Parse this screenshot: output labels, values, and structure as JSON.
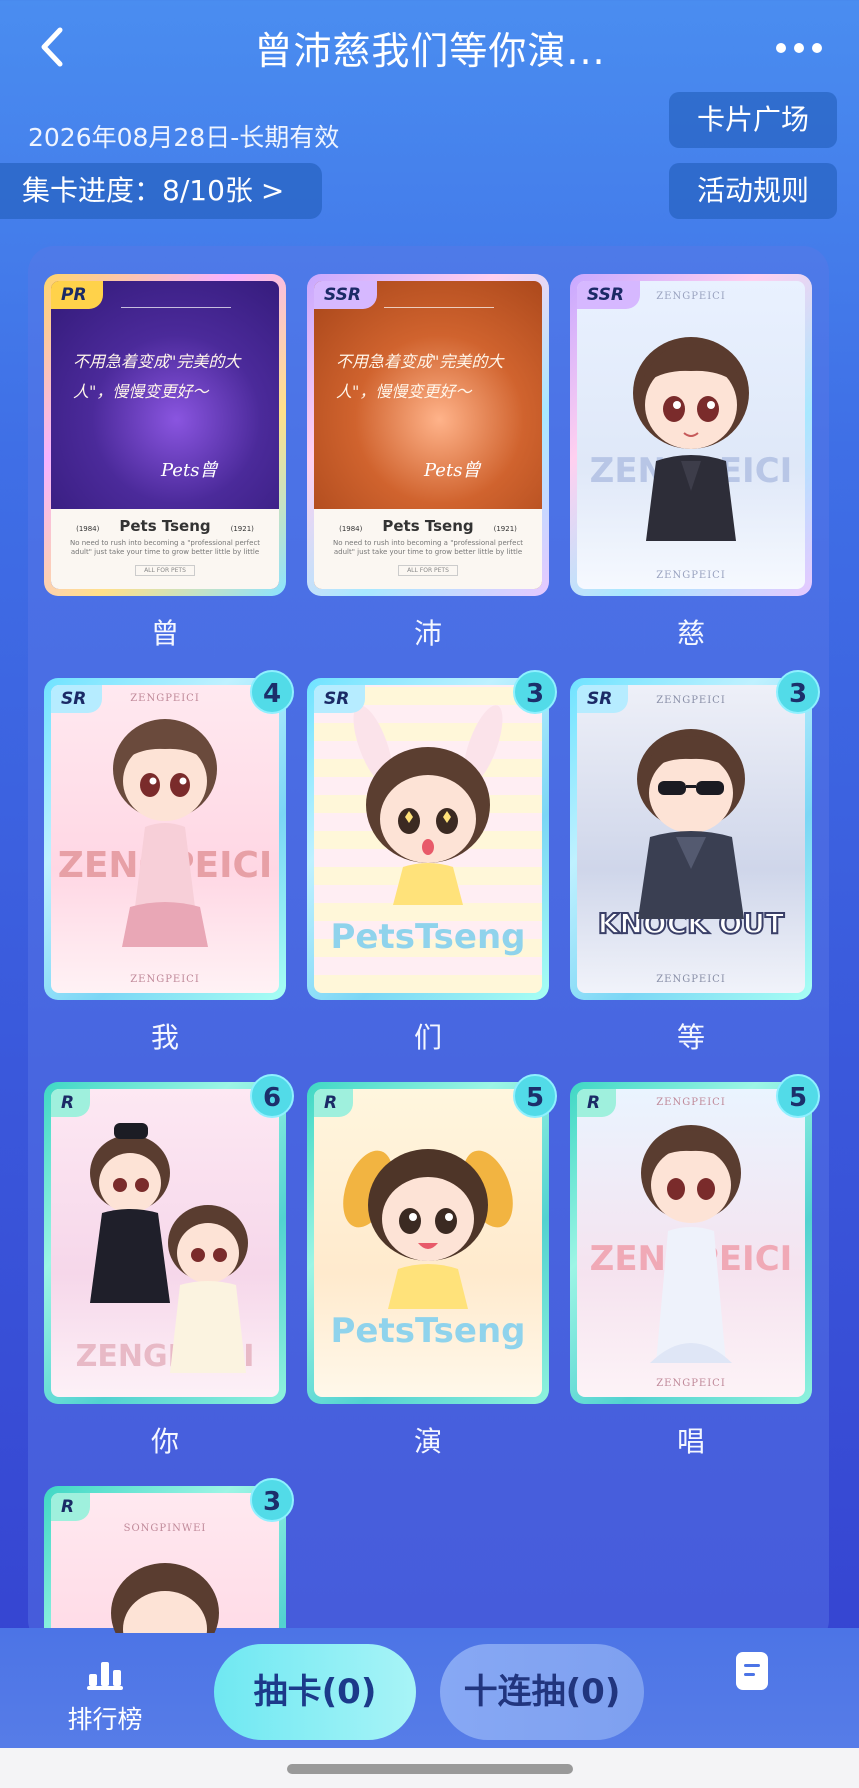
{
  "header": {
    "title": "曾沛慈我们等你演...",
    "back_icon": "chevron-left-icon",
    "more_icon": "more-dots-icon"
  },
  "info": {
    "date_range": "2026年08月28日-长期有效",
    "progress_label": "集卡进度：8/10张",
    "progress_chevron": ">",
    "card_square_label": "卡片广场",
    "rules_label": "活动规则"
  },
  "cards": [
    {
      "label": "曾",
      "rarity": "PR",
      "count": "",
      "style": "poem-purple",
      "name": "Pets Tseng",
      "poem": "不用急着变成\"完美的大人\"，慢慢变更好～",
      "sign": "Pets曾",
      "years_left": "(1984)",
      "years_right": "(1921)",
      "sub": "No need to rush into becoming a \"professional perfect adult\" just take your time to grow better little by little",
      "tag": "ALL FOR PETS"
    },
    {
      "label": "沛",
      "rarity": "SSR",
      "count": "",
      "style": "poem-orange",
      "name": "Pets Tseng",
      "poem": "不用急着变成\"完美的大人\"，慢慢变更好～",
      "sign": "Pets曾",
      "years_left": "(1984)",
      "years_right": "(1921)",
      "sub": "No need to rush into becoming a \"professional perfect adult\" just take your time to grow better little by little",
      "tag": "ALL FOR PETS"
    },
    {
      "label": "慈",
      "rarity": "SSR",
      "count": "",
      "top_text": "ZENGPEICI",
      "word": "ZENGPEICI",
      "bottom_text": "ZENGPEICI"
    },
    {
      "label": "我",
      "rarity": "SR",
      "count": "4",
      "top_text": "ZENGPEICI",
      "word": "ZENGPEICI",
      "bottom_text": "ZENGPEICI"
    },
    {
      "label": "们",
      "rarity": "SR",
      "count": "3",
      "word": "PetsTseng"
    },
    {
      "label": "等",
      "rarity": "SR",
      "count": "3",
      "top_text": "ZENGPEICI",
      "word": "KNOCK OUT",
      "bottom_text": "ZENGPEICI"
    },
    {
      "label": "你",
      "rarity": "R",
      "count": "6",
      "word": "ZENGPEICI"
    },
    {
      "label": "演",
      "rarity": "R",
      "count": "5",
      "word": "PetsTseng"
    },
    {
      "label": "唱",
      "rarity": "R",
      "count": "5",
      "top_text": "ZENGPEICI",
      "word": "ZENGPEICI",
      "bottom_text": "ZENGPEICI"
    },
    {
      "label": "",
      "rarity": "R",
      "count": "3",
      "top_text": "SONGPINWEI"
    }
  ],
  "bottom_bar": {
    "rank_label": "排行榜",
    "rank_icon": "bar-chart-icon",
    "draw_one_label": "抽卡(0)",
    "draw_ten_label": "十连抽(0)",
    "doc_icon": "document-icon"
  },
  "colors": {
    "accent_teal": "#52dbe8",
    "background_top": "#4a8df0",
    "background_bottom": "#3540cf"
  }
}
